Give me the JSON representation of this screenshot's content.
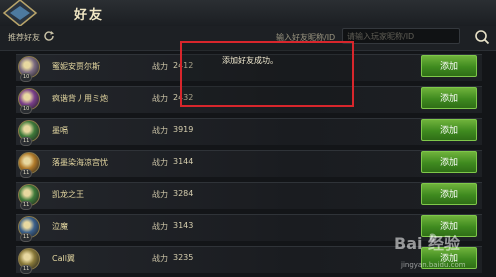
{
  "header": {
    "title": "好友"
  },
  "subbar": {
    "recommend_label": "推荐好友",
    "search_label": "输入好友昵称/ID",
    "search_placeholder": "请输入玩家昵称/ID"
  },
  "power_label": "战力",
  "add_label": "添加",
  "toast": {
    "message": "添加好友成功。"
  },
  "friends": [
    {
      "name": "蜜妮安贾尔斯",
      "level": "10",
      "power": "2412",
      "avatar_color": "#7a6a80"
    },
    {
      "name": "疯谐背丿用ミ炮",
      "level": "10",
      "power": "2432",
      "avatar_color": "#7a3f8a"
    },
    {
      "name": "墨嗝",
      "level": "11",
      "power": "3919",
      "avatar_color": "#3f7a3a"
    },
    {
      "name": "落墨染海凉宫忧",
      "level": "11",
      "power": "3144",
      "avatar_color": "#b07a2a"
    },
    {
      "name": "凯龙之王",
      "level": "11",
      "power": "3284",
      "avatar_color": "#3f7a3a"
    },
    {
      "name": "泣魔",
      "level": "11",
      "power": "3143",
      "avatar_color": "#3a5f8a"
    },
    {
      "name": "Call翼",
      "level": "11",
      "power": "3235",
      "avatar_color": "#8a7a3a"
    }
  ],
  "watermark": {
    "text": "Bai 经验",
    "url": "jingyan.baidu.com"
  }
}
